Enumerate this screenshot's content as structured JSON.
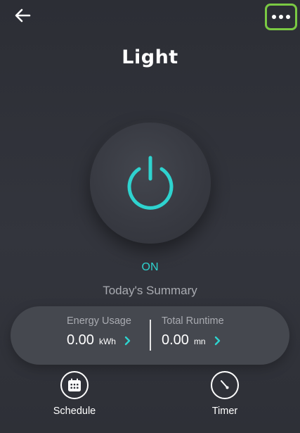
{
  "header": {
    "title": "Light",
    "back_icon": "arrow-left-icon",
    "more_icon": "more-horizontal-icon"
  },
  "power": {
    "icon": "power-icon",
    "state": "ON"
  },
  "summary": {
    "title": "Today's Summary",
    "energy": {
      "label": "Energy Usage",
      "value": "0.00",
      "unit": "kWh"
    },
    "runtime": {
      "label": "Total Runtime",
      "value": "0.00",
      "unit": "mn"
    }
  },
  "actions": [
    {
      "label": "Schedule",
      "icon": "calendar-icon"
    },
    {
      "label": "Timer",
      "icon": "timer-icon"
    }
  ],
  "colors": {
    "accent": "#2ed3cf",
    "background": "#2e3037",
    "card": "#45484f",
    "highlight": "#7ac943"
  }
}
